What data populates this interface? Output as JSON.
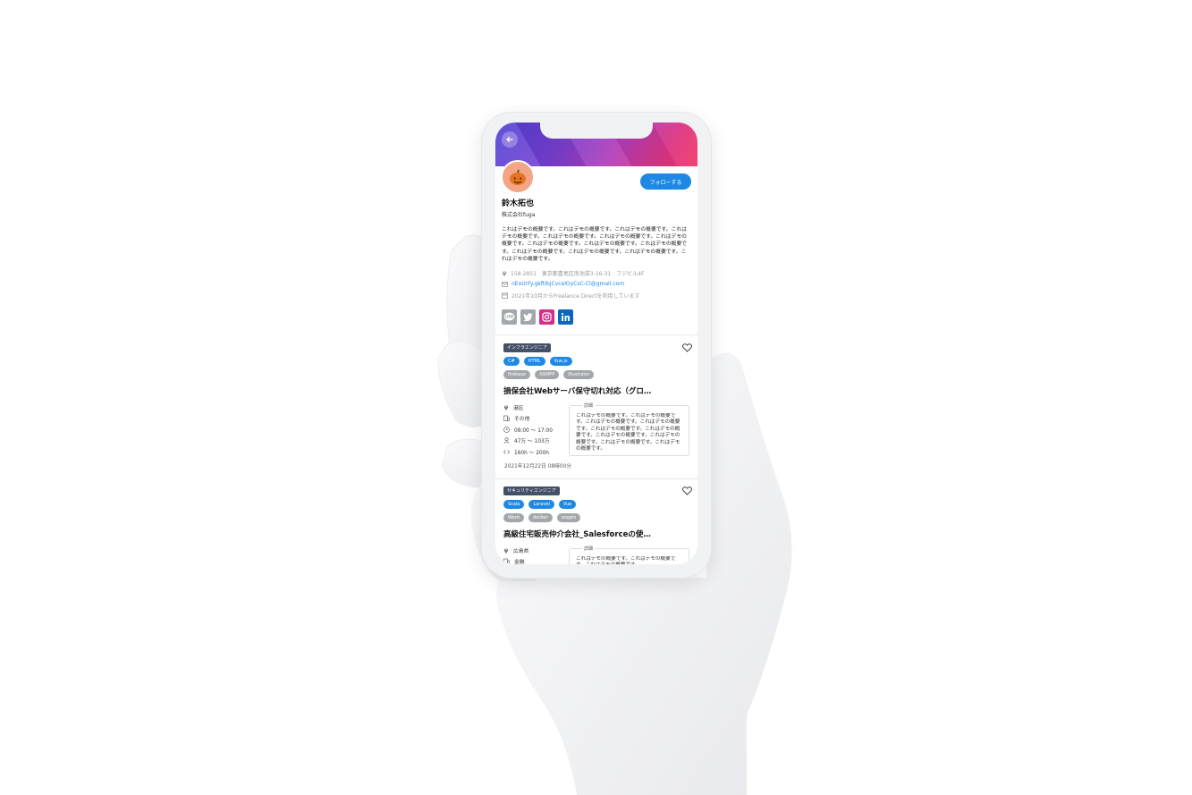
{
  "profile": {
    "name": "鈴木拓也",
    "company": "株式会社fuga",
    "follow_label": "フォローする",
    "bio": "これはデモの概要です。これはデモの概要です。これはデモの概要です。これはデモの概要です。これはデモの概要です。これはデモの概要です。これはデモの概要です。これはデモの概要です。これはデモの概要です。これはデモの概要です。これはデモの概要です。これはデモの概要です。これはデモの概要です。これはデモの概要です。",
    "address": "158-2851　東京都豊島区南池袋3-16-31　フジビル4F",
    "email": "nEoUrFy.gkftIbjCvcelOyCsC-Cl@gmail.com",
    "since": "2021年10月からFreelance Directを利用しています",
    "socials": [
      "line",
      "twitter",
      "instagram",
      "linkedin"
    ],
    "colors": {
      "line": "#a3a6ab",
      "twitter": "#a3a6ab",
      "instagram": "#d62d8a",
      "linkedin": "#0a66c2"
    }
  },
  "jobs": [
    {
      "category": "インフラエンジニア",
      "skills_primary": [
        "C#",
        "HTML",
        "Vue.js"
      ],
      "skills_secondary": [
        "firebase",
        "XAMPP",
        "Illustrator"
      ],
      "title": "損保会社Webサーバ保守切れ対応（グロ…",
      "location": "港区",
      "industry": "その他",
      "hours": "08:00 ～ 17:00",
      "salary": "47万 ～ 103万",
      "work_time": "160h ～ 200h",
      "detail_label": "詳細",
      "detail": "これはデモの概要です。これはデモの概要です。これはデモの概要です。これはデモの概要です。これはデモの概要です。これはデモの概要です。これはデモの概要です。これはデモの概要です。これはデモの概要です。これはデモの概要です。",
      "posted": "2021年12月22日 08時00分"
    },
    {
      "category": "セキュリティエンジニア",
      "skills_primary": [
        "Scala",
        "Laravel",
        "Vue"
      ],
      "skills_secondary": [
        "Word",
        "docker",
        "angels"
      ],
      "title": "高級住宅販売仲介会社_Salesforceの使…",
      "location": "広島県",
      "industry": "金融",
      "detail_label": "詳細",
      "detail": "これはデモの概要です。これはデモの概要です。これはデモの概要です。"
    }
  ]
}
